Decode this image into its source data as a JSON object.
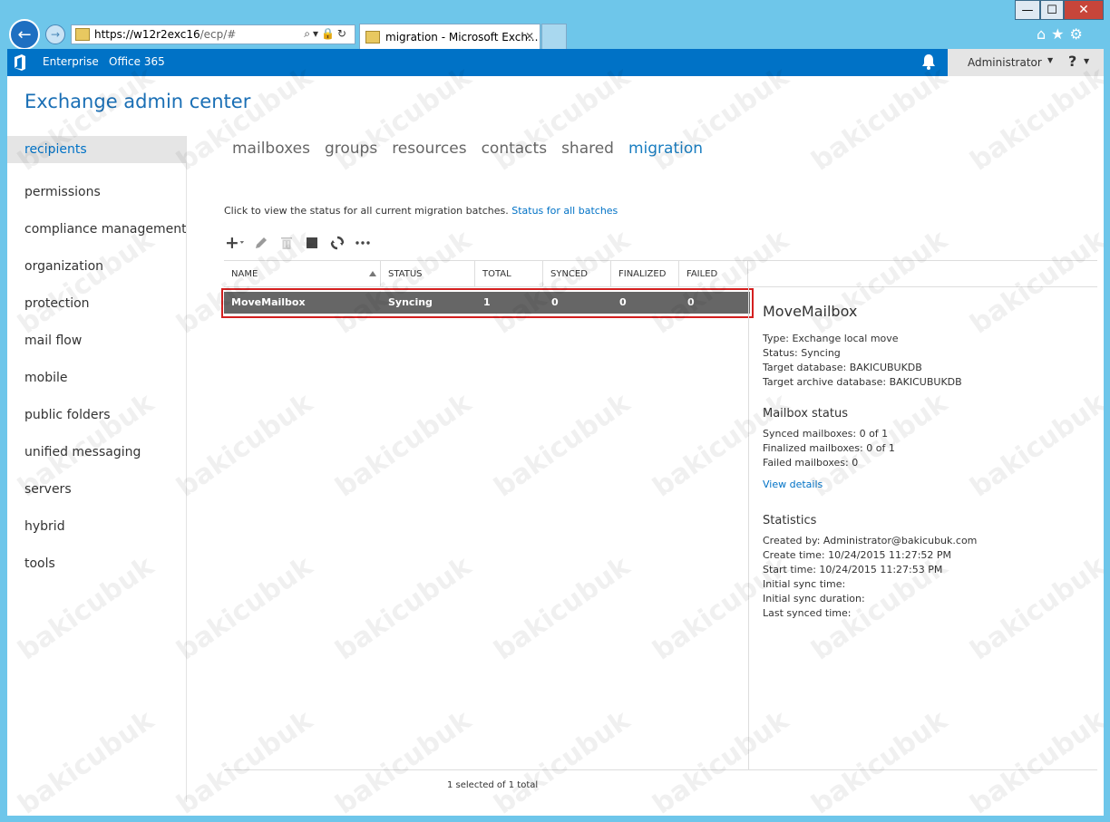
{
  "browser": {
    "window_controls": {
      "minimize": "—",
      "maximize": "☐",
      "close": "✕"
    },
    "address": {
      "host": "https://w12r2exc16",
      "path": "/ecp/#"
    },
    "tab_title": "migration - Microsoft Exch...",
    "tab_close": "✕"
  },
  "topbar": {
    "enterprise": "Enterprise",
    "office365": "Office 365",
    "user": "Administrator",
    "help": "?"
  },
  "app_title": "Exchange admin center",
  "leftnav": {
    "items": [
      "recipients",
      "permissions",
      "compliance management",
      "organization",
      "protection",
      "mail flow",
      "mobile",
      "public folders",
      "unified messaging",
      "servers",
      "hybrid",
      "tools"
    ],
    "active": "recipients"
  },
  "tabs": {
    "items": [
      "mailboxes",
      "groups",
      "resources",
      "contacts",
      "shared",
      "migration"
    ],
    "active": "migration"
  },
  "statusline": {
    "text": "Click to view the status for all current migration batches.",
    "link": "Status for all batches"
  },
  "table": {
    "headers": [
      "NAME",
      "STATUS",
      "TOTAL",
      "SYNCED",
      "FINALIZED",
      "FAILED"
    ],
    "rows": [
      {
        "name": "MoveMailbox",
        "status": "Syncing",
        "total": "1",
        "synced": "0",
        "finalized": "0",
        "failed": "0"
      }
    ],
    "footer": "1 selected of 1 total"
  },
  "details": {
    "title": "MoveMailbox",
    "type": "Type: Exchange local move",
    "status": "Status: Syncing",
    "target_db": "Target database: BAKICUBUKDB",
    "target_archive_db": "Target archive database: BAKICUBUKDB",
    "mailbox_status_heading": "Mailbox status",
    "synced": "Synced mailboxes: 0 of 1",
    "finalized": "Finalized mailboxes: 0 of 1",
    "failed": "Failed mailboxes: 0",
    "view_details": "View details",
    "statistics_heading": "Statistics",
    "created_by": "Created by: Administrator@bakicubuk.com",
    "create_time": "Create time: 10/24/2015 11:27:52 PM",
    "start_time": "Start time: 10/24/2015 11:27:53 PM",
    "initial_sync_time": "Initial sync time:",
    "initial_sync_duration": "Initial sync duration:",
    "last_synced": "Last synced time:"
  },
  "watermark": "bakicubuk",
  "colors": {
    "brand": "#0072c6",
    "selected_row": "#666666",
    "highlight": "#d42020"
  }
}
